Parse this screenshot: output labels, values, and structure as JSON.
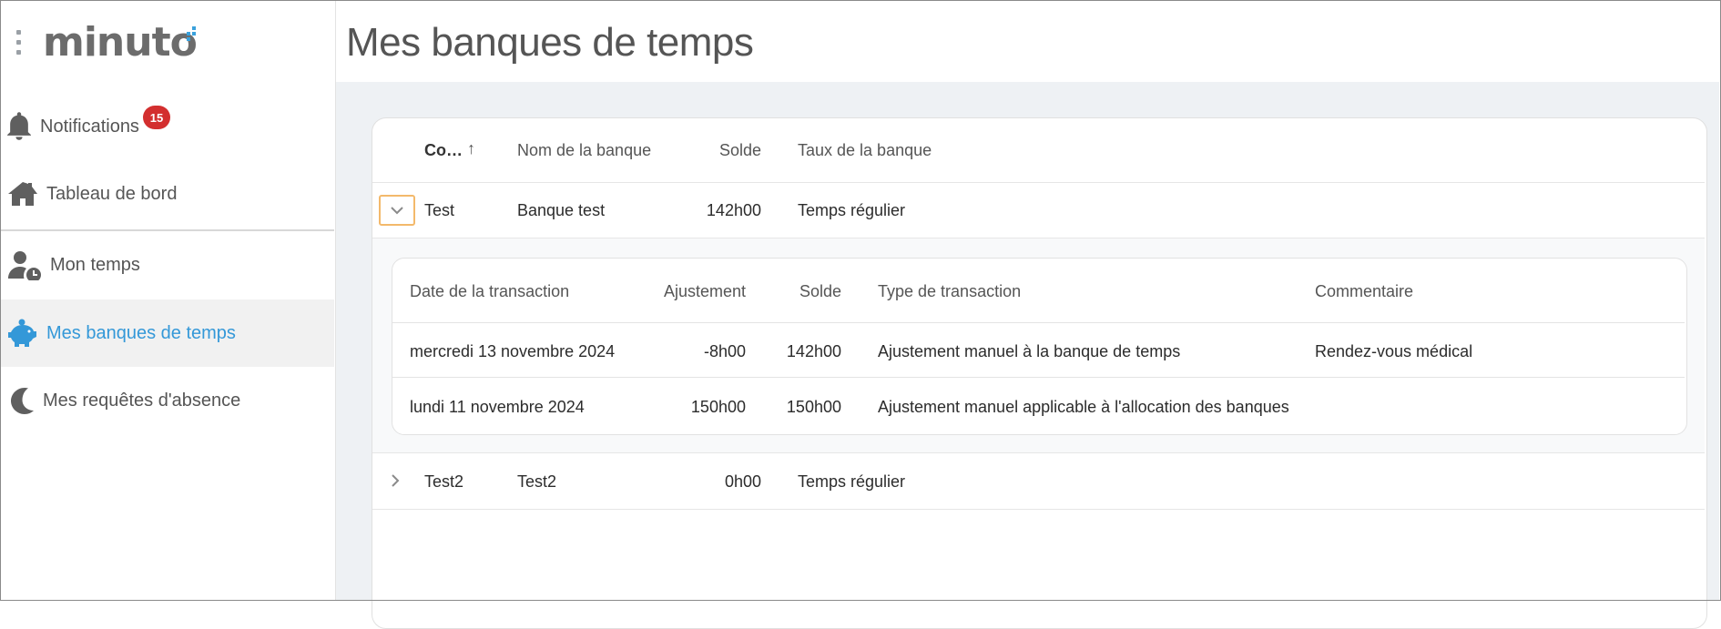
{
  "app": {
    "logo_text": "minuto",
    "page_title": "Mes banques de temps"
  },
  "sidebar": {
    "notifications": {
      "label": "Notifications",
      "badge": "15"
    },
    "items": [
      {
        "label": "Tableau de bord",
        "icon": "home-icon"
      },
      {
        "label": "Mon temps",
        "icon": "user-clock-icon"
      },
      {
        "label": "Mes banques de temps",
        "icon": "piggy-bank-icon",
        "active": true
      },
      {
        "label": "Mes requêtes d'absence",
        "icon": "moon-icon"
      }
    ]
  },
  "banks_table": {
    "headers": {
      "code": "Co…",
      "name": "Nom de la banque",
      "balance": "Solde",
      "rate": "Taux de la banque"
    },
    "sort_indicator": "↑",
    "rows": [
      {
        "code": "Test",
        "name": "Banque test",
        "balance": "142h00",
        "rate": "Temps régulier",
        "expanded": true
      },
      {
        "code": "Test2",
        "name": "Test2",
        "balance": "0h00",
        "rate": "Temps régulier",
        "expanded": false
      }
    ]
  },
  "transactions_table": {
    "headers": {
      "date": "Date de la transaction",
      "adjustment": "Ajustement",
      "balance": "Solde",
      "type": "Type de transaction",
      "comment": "Commentaire"
    },
    "rows": [
      {
        "date": "mercredi 13 novembre 2024",
        "adjustment": "-8h00",
        "balance": "142h00",
        "type": "Ajustement manuel à la banque de temps",
        "comment": "Rendez-vous médical"
      },
      {
        "date": "lundi 11 novembre 2024",
        "adjustment": "150h00",
        "balance": "150h00",
        "type": "Ajustement manuel applicable à l'allocation des banques",
        "comment": ""
      }
    ]
  },
  "colors": {
    "accent": "#3498d8",
    "badge": "#d32f2f",
    "focus": "#f3b96b",
    "background": "#eef1f4"
  }
}
